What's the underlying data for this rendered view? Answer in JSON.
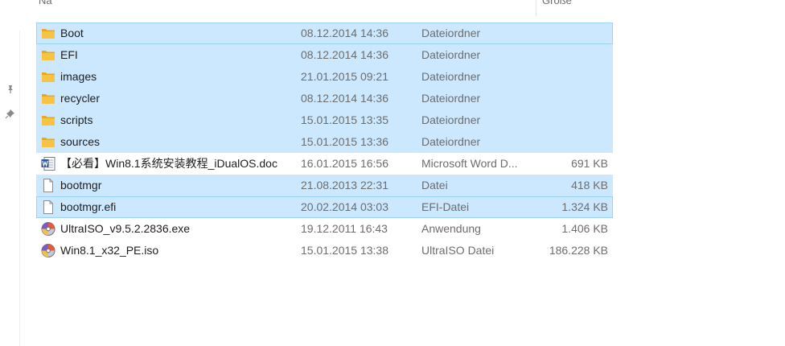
{
  "header": {
    "name_label": "Na",
    "size_label": "Größe"
  },
  "rows": [
    {
      "name": "Boot",
      "date": "08.12.2014 14:36",
      "type": "Dateiordner",
      "size": "",
      "icon": "folder-icon",
      "selected": true
    },
    {
      "name": "EFI",
      "date": "08.12.2014 14:36",
      "type": "Dateiordner",
      "size": "",
      "icon": "folder-icon",
      "selected": true
    },
    {
      "name": "images",
      "date": "21.01.2015 09:21",
      "type": "Dateiordner",
      "size": "",
      "icon": "folder-icon",
      "selected": true
    },
    {
      "name": "recycler",
      "date": "08.12.2014 14:36",
      "type": "Dateiordner",
      "size": "",
      "icon": "folder-icon",
      "selected": true
    },
    {
      "name": "scripts",
      "date": "15.01.2015 13:35",
      "type": "Dateiordner",
      "size": "",
      "icon": "folder-icon",
      "selected": true
    },
    {
      "name": "sources",
      "date": "15.01.2015 13:36",
      "type": "Dateiordner",
      "size": "",
      "icon": "folder-icon",
      "selected": true
    },
    {
      "name": "【必看】Win8.1系统安装教程_iDualOS.doc",
      "date": "16.01.2015 16:56",
      "type": "Microsoft Word D...",
      "size": "691 KB",
      "icon": "word-document-icon",
      "selected": false
    },
    {
      "name": "bootmgr",
      "date": "21.08.2013 22:31",
      "type": "Datei",
      "size": "418 KB",
      "icon": "blank-file-icon",
      "selected": true
    },
    {
      "name": "bootmgr.efi",
      "date": "20.02.2014 03:03",
      "type": "EFI-Datei",
      "size": "1.324 KB",
      "icon": "blank-file-icon",
      "selected": true
    },
    {
      "name": "UltraISO_v9.5.2.2836.exe",
      "date": "19.12.2011 16:43",
      "type": "Anwendung",
      "size": "1.406 KB",
      "icon": "ultraiso-disc-icon",
      "selected": false
    },
    {
      "name": "Win8.1_x32_PE.iso",
      "date": "15.01.2015 13:38",
      "type": "UltraISO Datei",
      "size": "186.228 KB",
      "icon": "ultraiso-disc-icon",
      "selected": false
    }
  ],
  "colors": {
    "selection": "#cce8ff",
    "selection_border": "#99d1ff",
    "folder": "#f6c343"
  }
}
